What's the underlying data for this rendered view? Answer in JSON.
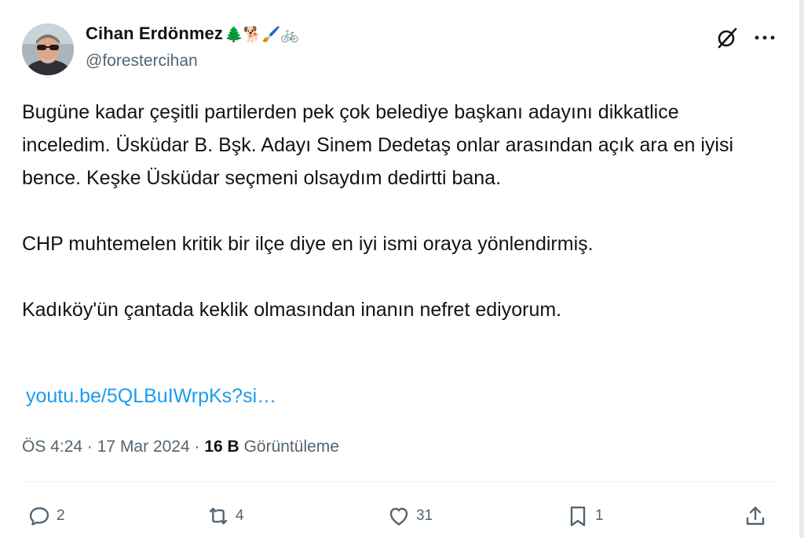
{
  "author": {
    "name": "Cihan Erdönmez",
    "emojis": "🌲🐕🖌️🚲",
    "handle": "@forestercihan"
  },
  "tweet": {
    "paragraphs": [
      "Bugüne kadar çeşitli partilerden pek çok belediye başkanı adayını dikkatlice inceledim. Üsküdar B. Bşk. Adayı Sinem Dedetaş onlar arasından açık ara en iyisi bence. Keşke Üsküdar seçmeni olsaydım dedirtti bana.",
      "CHP muhtemelen kritik bir ilçe diye en iyi ismi oraya yönlendirmiş.",
      "Kadıköy'ün çantada keklik olmasından inanın nefret ediyorum."
    ],
    "link": "youtu.be/5QLBuIWrpKs?si…"
  },
  "meta": {
    "time": "ÖS 4:24",
    "sep1": "·",
    "date": "17 Mar 2024",
    "sep2": "·",
    "views_count": "16 B",
    "views_label": "Görüntüleme"
  },
  "actions": {
    "replies": "2",
    "reposts": "4",
    "likes": "31",
    "bookmarks": "1"
  },
  "icons": [
    "avatar",
    "grok-icon",
    "more-icon",
    "reply-icon",
    "repost-icon",
    "like-icon",
    "bookmark-icon",
    "share-icon"
  ],
  "colors": {
    "link": "#1d9bf0",
    "secondary": "#536471",
    "text": "#0f1419"
  }
}
